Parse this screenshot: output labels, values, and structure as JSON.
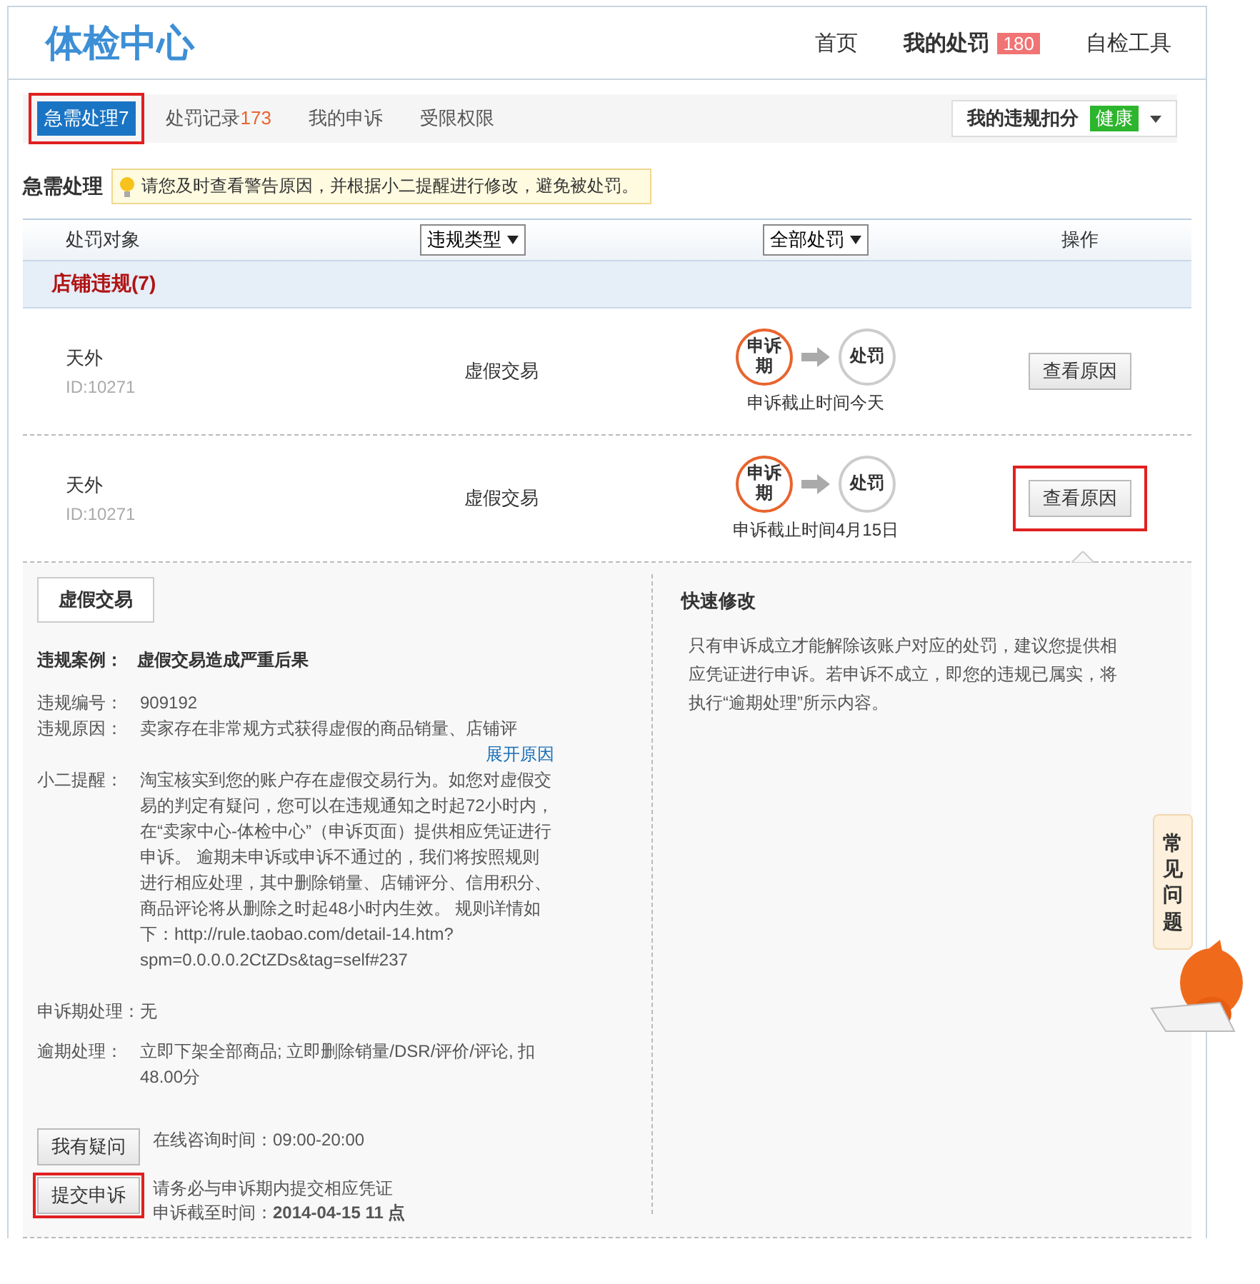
{
  "header": {
    "title": "体检中心",
    "nav": [
      {
        "label": "首页",
        "selected": false
      },
      {
        "label": "我的处罚",
        "selected": true,
        "badge": "180"
      },
      {
        "label": "自检工具",
        "selected": false
      }
    ]
  },
  "tabs": [
    {
      "label": "急需处理",
      "count": "7",
      "selected": true,
      "highlighted": true
    },
    {
      "label": "处罚记录",
      "count": "173",
      "selected": false,
      "highlighted": false
    },
    {
      "label": "我的申诉",
      "selected": false,
      "highlighted": false
    },
    {
      "label": "受限权限",
      "selected": false,
      "highlighted": false
    }
  ],
  "score_menu": {
    "label": "我的违规扣分",
    "status": "健康"
  },
  "section": {
    "title": "急需处理",
    "tip": "请您及时查看警告原因，并根据小二提醒进行修改，避免被处罚。"
  },
  "table": {
    "columns": [
      {
        "label": "处罚对象",
        "kind": "text"
      },
      {
        "label": "违规类型",
        "kind": "dropdown"
      },
      {
        "label": "全部处罚",
        "kind": "dropdown"
      },
      {
        "label": "操作",
        "kind": "text"
      }
    ],
    "group": "店铺违规(7)",
    "rows": [
      {
        "name": "天外",
        "id": "ID:10271",
        "type": "虚假交易",
        "steps": [
          {
            "label": "申诉期",
            "active": true
          },
          {
            "label": "处罚",
            "active": false
          }
        ],
        "deadline": "申诉截止时间今天",
        "action": "查看原因",
        "highlighted": false,
        "expanded": false
      },
      {
        "name": "天外",
        "id": "ID:10271",
        "type": "虚假交易",
        "steps": [
          {
            "label": "申诉期",
            "active": true
          },
          {
            "label": "处罚",
            "active": false
          }
        ],
        "deadline": "申诉截止时间4月15日",
        "action": "查看原因",
        "highlighted": true,
        "expanded": true
      }
    ]
  },
  "detail": {
    "tag": "虚假交易",
    "case_label": "违规案例：",
    "case_value": "虚假交易造成严重后果",
    "fields": [
      {
        "label": "违规编号：",
        "value": "909192"
      },
      {
        "label": "违规原因：",
        "value": "卖家存在非常规方式获得虚假的商品销量、店铺评",
        "link": "展开原因"
      },
      {
        "label": "小二提醒：",
        "value": "淘宝核实到您的账户存在虚假交易行为。如您对虚假交易的判定有疑问，您可以在违规通知之时起72小时内，在“卖家中心-体检中心”（申诉页面）提供相应凭证进行申诉。 逾期未申诉或申诉不通过的，我们将按照规则进行相应处理，其中删除销量、店铺评分、信用积分、商品评论将从删除之时起48小时内生效。 规则详情如下：http://rule.taobao.com/detail-14.htm?spm=0.0.0.0.2CtZDs&tag=self#237"
      },
      {
        "label": "申诉期处理：",
        "value": "无"
      },
      {
        "label": "逾期处理：",
        "value": "立即下架全部商品; 立即删除销量/DSR/评价/评论, 扣48.00分"
      }
    ],
    "actions": [
      {
        "label": "我有疑问",
        "highlighted": false,
        "notes": [
          "在线咨询时间：09:00-20:00"
        ]
      },
      {
        "label": "提交申诉",
        "highlighted": true,
        "notes": [
          "请务必与申诉期内提交相应凭证",
          "申诉截至时间：**2014-04-15 11 点**"
        ]
      }
    ],
    "quick_title": "快速修改",
    "quick_text": "只有申诉成立才能解除该账户对应的处罚，建议您提供相应凭证进行申诉。若申诉不成立，即您的违规已属实，将执行“逾期处理”所示内容。"
  },
  "faq": {
    "label": "常见问题"
  }
}
